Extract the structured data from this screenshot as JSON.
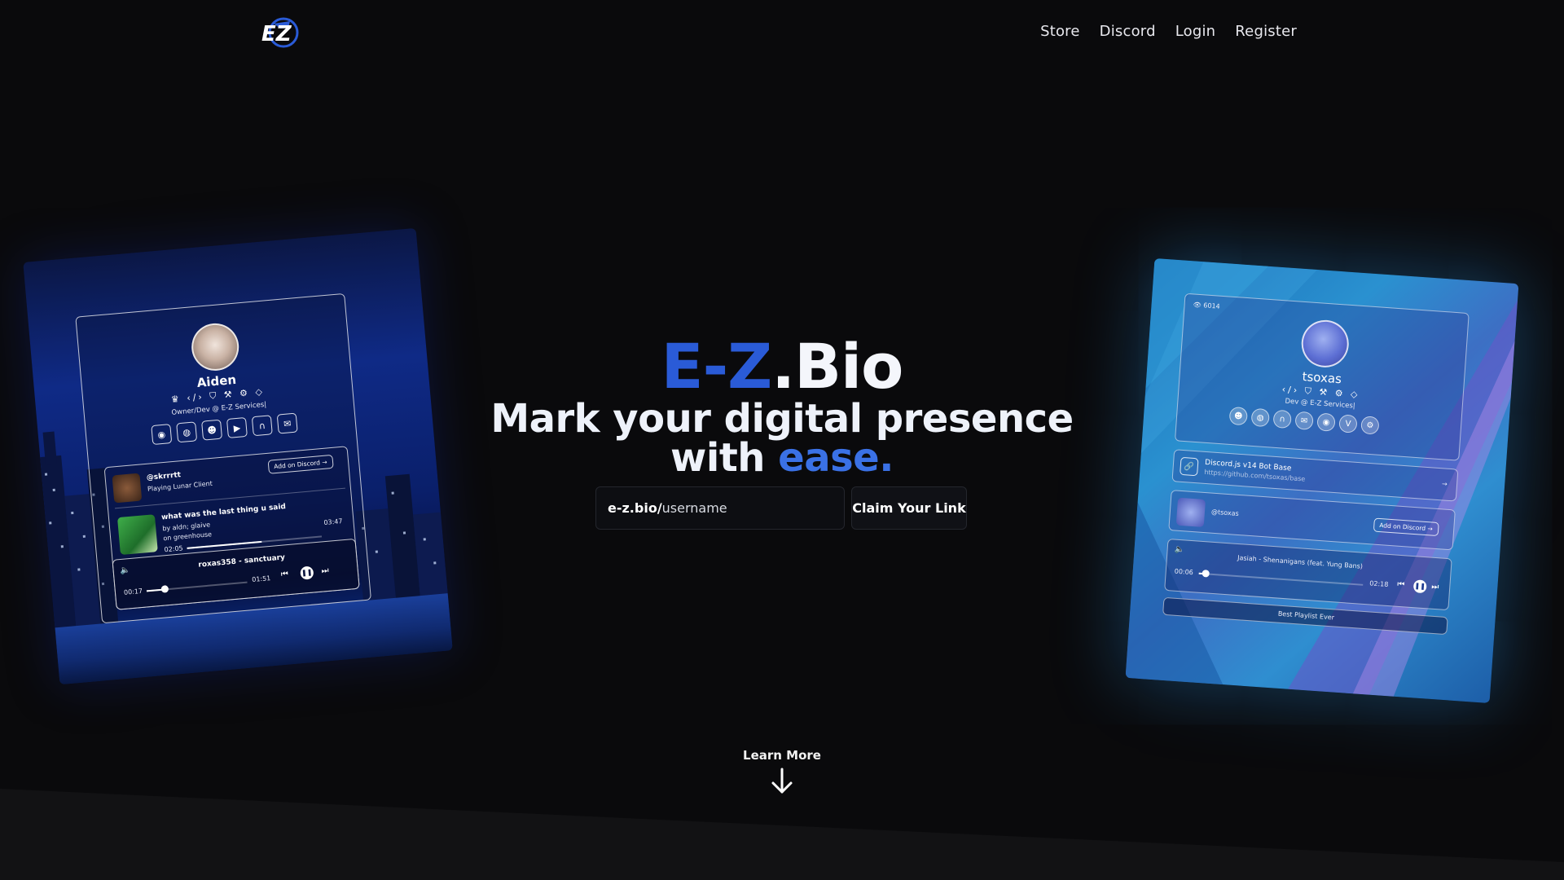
{
  "nav": {
    "logo_text": "EZ",
    "links": [
      "Store",
      "Discord",
      "Login",
      "Register"
    ]
  },
  "hero": {
    "brand_part1": "E-Z",
    "brand_part2": ".Bio",
    "tagline_line1": "Mark your digital presence",
    "tagline_line2_prefix": "with ",
    "tagline_line2_accent": "ease."
  },
  "claim": {
    "url_prefix": "e-z.bio/",
    "input_placeholder": "username",
    "button_label": "Claim Your Link"
  },
  "learn_more": {
    "label": "Learn More"
  },
  "left_card": {
    "name": "Aiden",
    "subtitle": "Owner/Dev @ E-Z Services|",
    "badges": "♛ ‹/› ⛉ ⚒ ⚙ ◇",
    "icons": [
      "user-icon",
      "github-icon",
      "discord-icon",
      "youtube-icon",
      "namemc-icon",
      "mail-icon"
    ],
    "discord": {
      "handle": "@skrrrtt",
      "status": "Playing Lunar Client",
      "add_label": "Add on Discord →"
    },
    "track": {
      "title": "what was the last thing u said",
      "artist": "by aldn; glaive",
      "album": "on greenhouse",
      "time_start": "02:05",
      "time_end": "03:47"
    },
    "player": {
      "title": "roxas358 - sanctuary",
      "time_start": "00:17",
      "time_end": "01:51"
    }
  },
  "right_card": {
    "views": "6014",
    "name": "tsoxas",
    "subtitle": "Dev @ E-Z Services|",
    "badges": "‹/› ⛉ ⚒ ⚙ ◇",
    "link": {
      "title": "Discord.js v14 Bot Base",
      "url": "https://github.com/tsoxas/base",
      "arrow": "→"
    },
    "discord": {
      "handle": "@tsoxas",
      "add_label": "Add on Discord →"
    },
    "player": {
      "title": "Jasiah - Shenanigans (feat. Yung Bans)",
      "time_start": "00:06",
      "time_end": "02:18"
    },
    "playlist_label": "Best Playlist Ever"
  },
  "colors": {
    "background": "#0a0a0c",
    "brand_blue": "#2a5bd7",
    "accent_blue": "#3a71e6"
  }
}
